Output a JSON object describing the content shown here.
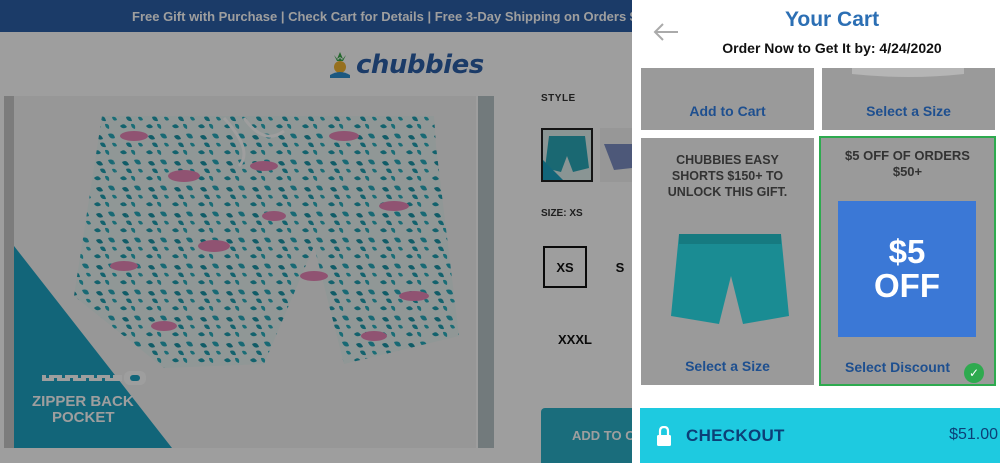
{
  "banner": {
    "text": "Free Gift with Purchase | Check Cart for Details | Free 3-Day Shipping on Orders $"
  },
  "logo": {
    "text": "chubbies"
  },
  "product": {
    "badge_text_1": "ZIPPER BACK",
    "badge_text_2": "POCKET",
    "style_label": "STYLE",
    "size_label": "SIZE: XS",
    "sizes": [
      "XS",
      "S",
      "XXXL"
    ],
    "add_to_cart": "ADD TO C"
  },
  "cart": {
    "title": "Your Cart",
    "order_by": "Order Now to Get It by: 4/24/2020",
    "card_add_to_cart": "Add to Cart",
    "card_select_size_top": "Select a Size",
    "gift_desc": "CHUBBIES EASY SHORTS $150+ TO UNLOCK THIS GIFT.",
    "gift_select_size": "Select a Size",
    "discount_desc": "$5 OFF OF ORDERS $50+",
    "discount_amount_1": "$5",
    "discount_amount_2": "OFF",
    "discount_select": "Select Discount",
    "checkout_label": "CHECKOUT",
    "checkout_total": "$51.00"
  },
  "colors": {
    "brand_blue": "#2c5fa8",
    "checkout_cyan": "#1ecae0",
    "discount_blue": "#3b78d6",
    "selected_green": "#2eaa4f"
  }
}
